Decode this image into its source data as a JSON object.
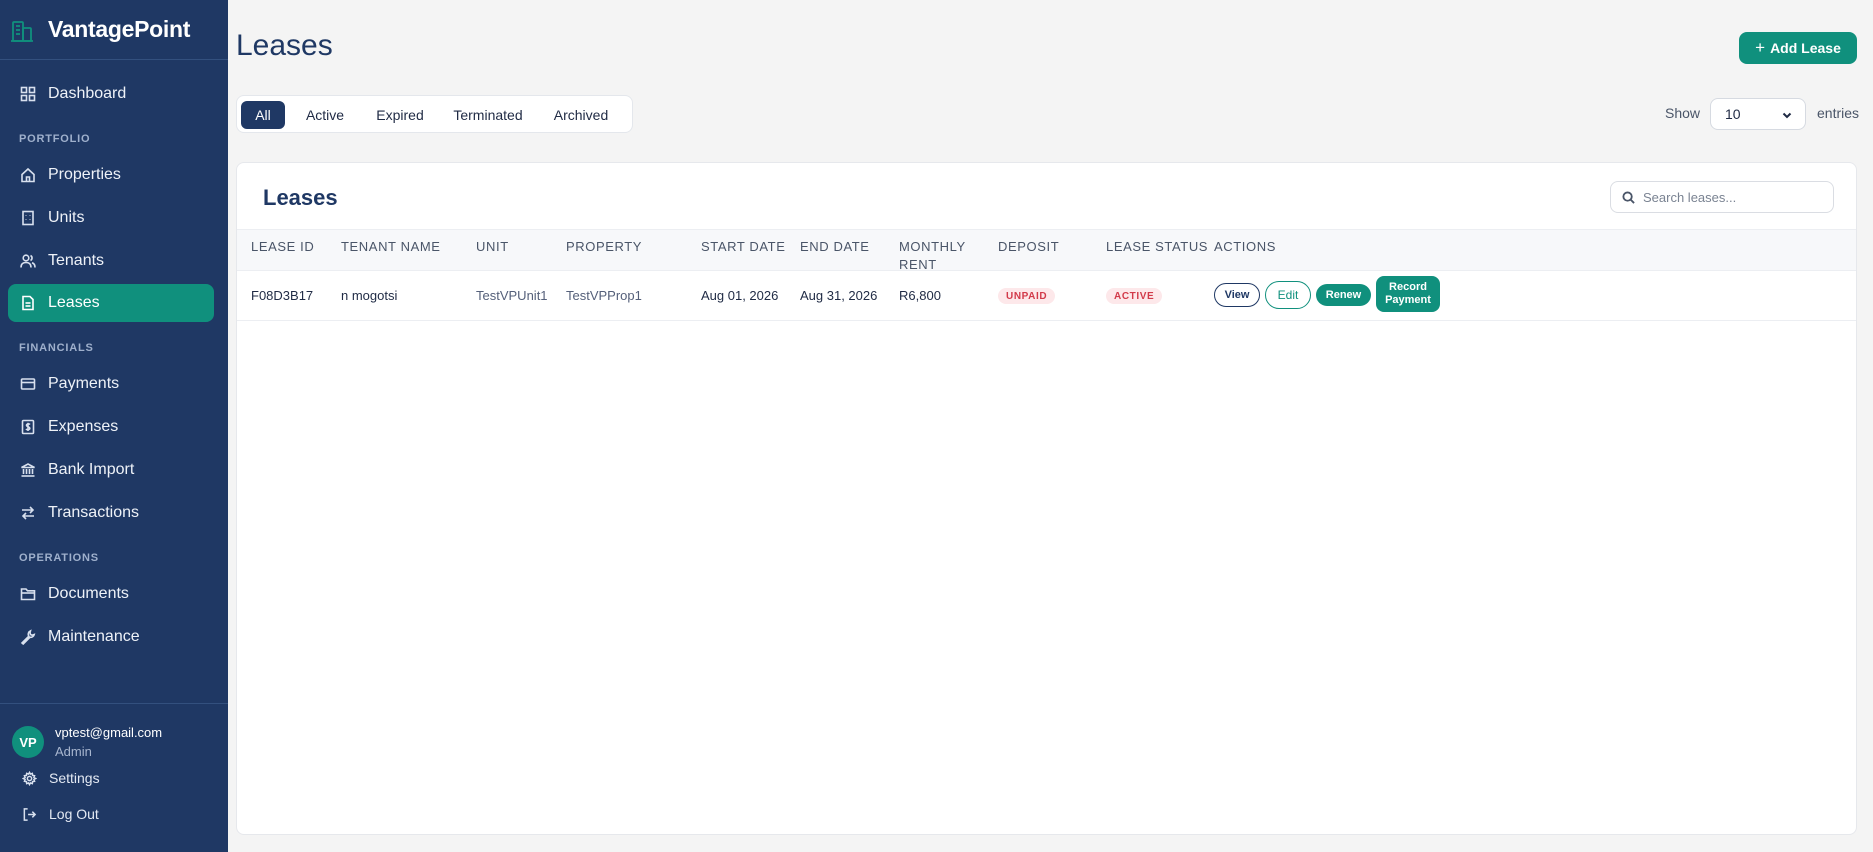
{
  "brand": {
    "name": "VantagePoint"
  },
  "sidebar": {
    "dashboard": "Dashboard",
    "section_portfolio": "PORTFOLIO",
    "properties": "Properties",
    "units": "Units",
    "tenants": "Tenants",
    "leases": "Leases",
    "section_financials": "FINANCIALS",
    "payments": "Payments",
    "expenses": "Expenses",
    "bank_import": "Bank Import",
    "transactions": "Transactions",
    "section_operations": "OPERATIONS",
    "documents": "Documents",
    "maintenance": "Maintenance",
    "active_item": "Leases"
  },
  "user": {
    "initials": "VP",
    "email": "vptest@gmail.com",
    "role": "Admin",
    "settings": "Settings",
    "logout": "Log Out"
  },
  "page": {
    "title": "Leases",
    "add_button": "Add Lease"
  },
  "filters": {
    "tabs": [
      "All",
      "Active",
      "Expired",
      "Terminated",
      "Archived"
    ],
    "selected": "All"
  },
  "pagination": {
    "show_label": "Show",
    "entries_value": "10",
    "entries_label": "entries"
  },
  "table_card": {
    "title": "Leases",
    "search_placeholder": "Search leases...",
    "columns": [
      "LEASE ID",
      "TENANT NAME",
      "UNIT",
      "PROPERTY",
      "START DATE",
      "END DATE",
      "MONTHLY RENT",
      "DEPOSIT",
      "LEASE STATUS",
      "ACTIONS"
    ],
    "rows": [
      {
        "lease_id": "F08D3B17",
        "tenant_name": "n mogotsi",
        "unit": "TestVPUnit1",
        "property": "TestVPProp1",
        "start_date": "Aug 01, 2026",
        "end_date": "Aug 31, 2026",
        "monthly_rent": "R6,800",
        "deposit": "UNPAID",
        "lease_status": "ACTIVE",
        "actions": {
          "view": "View",
          "edit": "Edit",
          "renew": "Renew",
          "record_payment": "Record Payment"
        }
      }
    ]
  },
  "colors": {
    "sidebar_bg": "#1f3864",
    "accent": "#10907d",
    "page_bg": "#f4f4f4",
    "badge_bg": "#fde8ea",
    "badge_text": "#d23a4a"
  }
}
